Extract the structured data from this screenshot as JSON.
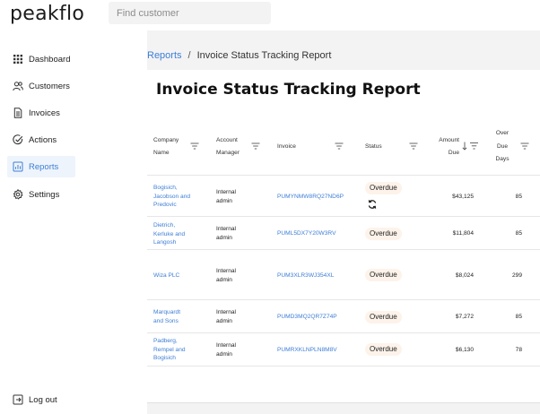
{
  "app": {
    "logo": "peakflo"
  },
  "search": {
    "placeholder": "Find customer",
    "value": ""
  },
  "sidebar": {
    "items": [
      {
        "label": "Dashboard",
        "icon": "grid-icon"
      },
      {
        "label": "Customers",
        "icon": "people-icon"
      },
      {
        "label": "Invoices",
        "icon": "document-icon"
      },
      {
        "label": "Actions",
        "icon": "check-circle-icon"
      },
      {
        "label": "Reports",
        "icon": "report-icon",
        "active": true
      },
      {
        "label": "Settings",
        "icon": "gear-icon"
      }
    ],
    "logout": "Log out"
  },
  "breadcrumb": {
    "root": "Reports",
    "separator": "/",
    "current": "Invoice Status Tracking Report"
  },
  "report": {
    "title": "Invoice Status Tracking Report",
    "columns": {
      "company": [
        "Company",
        "Name"
      ],
      "account": [
        "Account",
        "Manager"
      ],
      "invoice": "Invoice",
      "status": "Status",
      "amount": [
        "Amount",
        "Due"
      ],
      "overdue": [
        "Over",
        "Due",
        "Days"
      ]
    },
    "rows": [
      {
        "company": [
          "Bogisich,",
          "Jacobson and",
          "Predovic"
        ],
        "manager": [
          "Internal",
          "admin"
        ],
        "invoice": "PUMYNMW8RQ27ND6P",
        "status": "Overdue",
        "amount": "$43,125",
        "days": "85",
        "sync_icon": true
      },
      {
        "company": [
          "Dietrich,",
          "Kerluke and",
          "Langosh"
        ],
        "manager": [
          "Internal",
          "admin"
        ],
        "invoice": "PUML5DX7Y20W3RV",
        "status": "Overdue",
        "amount": "$11,804",
        "days": "85"
      },
      {
        "company": [
          "Wiza PLC"
        ],
        "manager": [
          "Internal",
          "admin"
        ],
        "invoice": "PUM3XLR3WJ354XL",
        "status": "Overdue",
        "amount": "$8,024",
        "days": "299"
      },
      {
        "company": [
          "Marquardt",
          "and Sons"
        ],
        "manager": [
          "Internal",
          "admin"
        ],
        "invoice": "PUMD3MQ2QR7Z74P",
        "status": "Overdue",
        "amount": "$7,272",
        "days": "85"
      },
      {
        "company": [
          "Padberg,",
          "Rempel and",
          "Bogisich"
        ],
        "manager": [
          "Internal",
          "admin"
        ],
        "invoice": "PUMRXKLNPLN8M8V",
        "status": "Overdue",
        "amount": "$6,130",
        "days": "78"
      }
    ]
  },
  "colors": {
    "accent": "#3d7ed6",
    "badge_bg": "#fdf3ea",
    "active_bg": "#eef4fb"
  }
}
